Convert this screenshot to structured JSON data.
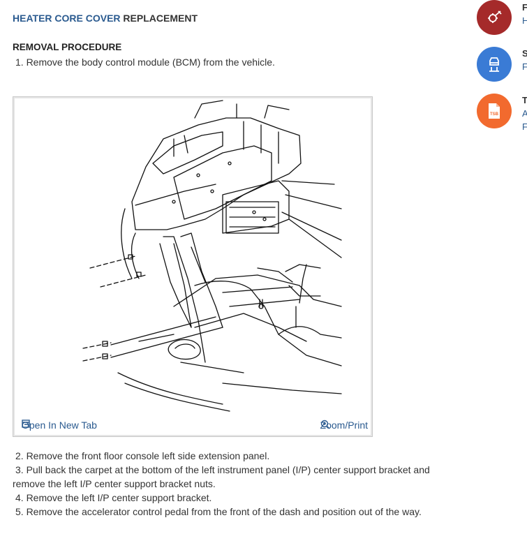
{
  "article": {
    "title_link": "HEATER CORE COVER",
    "title_rest": " REPLACEMENT",
    "heading": "REMOVAL PROCEDURE",
    "steps": [
      "1. Remove the body control module (BCM) from the vehicle.",
      "2. Remove the front floor console left side extension panel.",
      "3. Pull back the carpet at the bottom of the left instrument panel (I/P) center support bracket and",
      "remove the left I/P center support bracket nuts.",
      "4. Remove the left I/P center support bracket.",
      "5. Remove the accelerator control pedal from the front of the dash and position out of the way."
    ]
  },
  "figure": {
    "open_tab_label": "Open In New Tab",
    "zoom_label": "Zoom/Print"
  },
  "sidebar": {
    "items": [
      {
        "icon": "wrench-gear-icon",
        "color": "#a52a2a",
        "label": "F",
        "sub": "H"
      },
      {
        "icon": "car-lift-icon",
        "color": "#3a7bd5",
        "label": "S",
        "sub": "F"
      },
      {
        "icon": "tsb-document-icon",
        "color": "#f26a2e",
        "label": "T",
        "sub": "A",
        "sub2": "F",
        "badge": "TSB"
      }
    ]
  }
}
